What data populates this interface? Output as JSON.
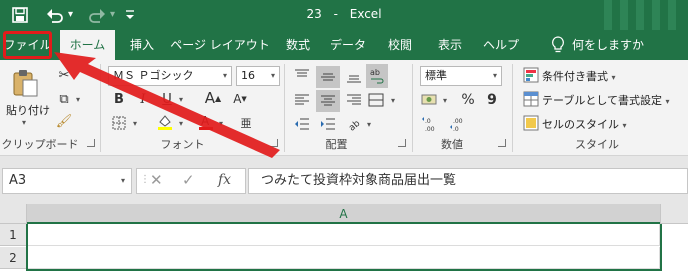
{
  "titlebar": {
    "filename": "23",
    "separator": "-",
    "app": "Excel",
    "colors": {
      "excel_green": "#217346",
      "arrow_red": "#e21b1b"
    }
  },
  "quick_access": [
    {
      "name": "save-icon",
      "glyph": "💾"
    },
    {
      "name": "undo-icon",
      "glyph": "↶"
    },
    {
      "name": "redo-icon",
      "glyph": "↷"
    },
    {
      "name": "customize-qat-icon",
      "glyph": "⩡"
    }
  ],
  "tabs": [
    {
      "label": "ファイル"
    },
    {
      "label": "ホーム",
      "active": true
    },
    {
      "label": "挿入"
    },
    {
      "label": "ページ レイアウト"
    },
    {
      "label": "数式"
    },
    {
      "label": "データ"
    },
    {
      "label": "校閲"
    },
    {
      "label": "表示"
    },
    {
      "label": "ヘルプ"
    },
    {
      "label": "何をしますか",
      "icon": "lightbulb-icon"
    }
  ],
  "ribbon": {
    "clipboard": {
      "paste_label": "貼り付け",
      "group_label": "クリップボード"
    },
    "font": {
      "font_name": "ＭＳ Ｐゴシック",
      "font_size": "16",
      "bold": "B",
      "italic": "I",
      "underline": "U",
      "grow": "A",
      "shrink": "A",
      "group_label": "フォント"
    },
    "alignment": {
      "group_label": "配置"
    },
    "number": {
      "format": "標準",
      "percent": "%",
      "comma": "9",
      "group_label": "数値"
    },
    "styles": {
      "conditional": "条件付き書式",
      "table": "テーブルとして書式設定",
      "cell_styles": "セルのスタイル",
      "group_label": "スタイル"
    }
  },
  "formula_bar": {
    "cell_ref": "A3",
    "fx": "fx",
    "value": "つみたて投資枠対象商品届出一覧"
  },
  "sheet": {
    "columns": [
      "A"
    ],
    "rows": [
      "1",
      "2"
    ]
  }
}
